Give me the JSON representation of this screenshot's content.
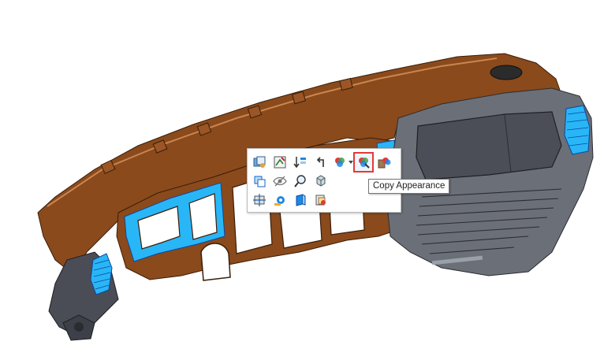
{
  "tooltip": {
    "text": "Copy Appearance"
  },
  "colors": {
    "model_brown": "#8a4a1c",
    "model_brown_dark": "#5b2e0e",
    "model_gray": "#6b6f78",
    "model_gray_dark": "#3d4048",
    "highlight_blue": "#29b6f6",
    "highlight_outline": "#e53935"
  },
  "toolbar": {
    "row1": [
      {
        "icon": "component-appearance-icon"
      },
      {
        "icon": "edit-sketch-icon"
      },
      {
        "icon": "rollback-icon"
      },
      {
        "icon": "undo-arrow-icon"
      },
      {
        "icon": "appearance-icon"
      },
      {
        "icon": "copy-appearance-icon"
      },
      {
        "icon": "paste-appearance-icon"
      }
    ],
    "row2": [
      {
        "icon": "hide-show-icon"
      },
      {
        "icon": "hide-eye-icon"
      },
      {
        "icon": "zoom-to-selection-icon"
      },
      {
        "icon": "isolate-icon"
      }
    ],
    "row3": [
      {
        "icon": "normal-to-icon"
      },
      {
        "icon": "measure-icon"
      },
      {
        "icon": "section-view-icon"
      },
      {
        "icon": "selection-tools-icon"
      }
    ]
  }
}
